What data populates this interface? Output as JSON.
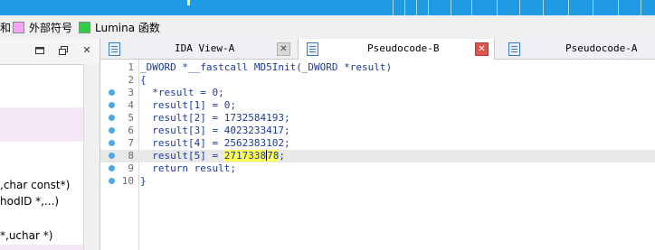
{
  "legend": {
    "items": [
      {
        "label": "和",
        "color": ""
      },
      {
        "label": "外部符号",
        "color": "#f7a3f7"
      },
      {
        "label": "Lumina 函数",
        "color": "#33cc44"
      }
    ]
  },
  "left_panel": {
    "controls": {
      "close_glyph": "✕"
    },
    "signatures": [
      ",char const*)",
      "hodID *,...)",
      "*,uchar *)"
    ]
  },
  "tabs": [
    {
      "label": "IDA View-A",
      "close_glyph": "✕",
      "active": false
    },
    {
      "label": "Pseudocode-B",
      "close_glyph": "✕",
      "active": true
    },
    {
      "label": "Pseudocode-A",
      "active": false
    }
  ],
  "editor": {
    "selected_text": "271733878",
    "lines": [
      {
        "num": "1",
        "text": "_DWORD *__fastcall MD5Init(_DWORD *result)",
        "dot": false
      },
      {
        "num": "2",
        "text": "{",
        "dot": false
      },
      {
        "num": "3",
        "text": "  *result = 0;",
        "dot": true
      },
      {
        "num": "4",
        "text": "  result[1] = 0;",
        "dot": true
      },
      {
        "num": "5",
        "text": "  result[2] = 1732584193;",
        "dot": true
      },
      {
        "num": "6",
        "text": "  result[3] = 4023233417;",
        "dot": true
      },
      {
        "num": "7",
        "text": "  result[4] = 2562383102;",
        "dot": true
      },
      {
        "num": "8",
        "text": "  result[5] = 271733878;",
        "dot": true,
        "current": true
      },
      {
        "num": "9",
        "text": "  return result;",
        "dot": true
      },
      {
        "num": "10",
        "text": "}",
        "dot": true
      }
    ]
  }
}
